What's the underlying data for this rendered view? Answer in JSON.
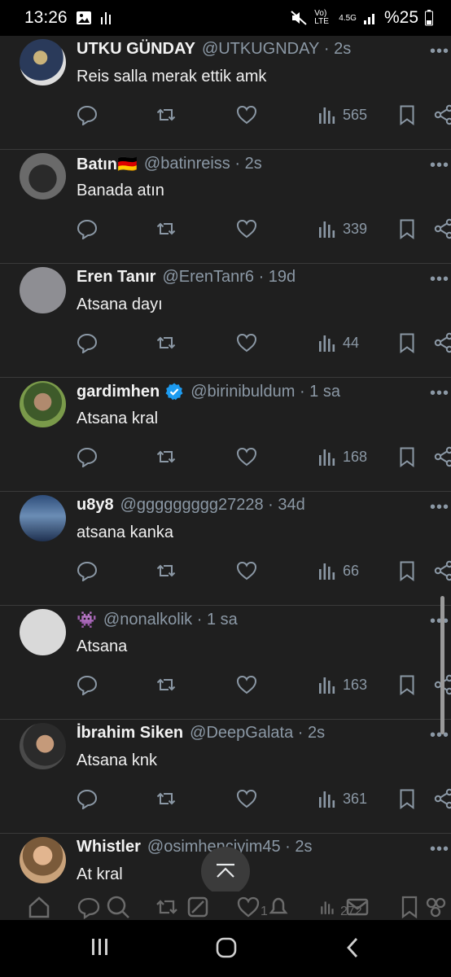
{
  "status_bar": {
    "time": "13:26",
    "network": "Vo) LTE",
    "signal": "4.5G",
    "battery": "%25"
  },
  "tweets": [
    {
      "name": "UTKU GÜNDAY",
      "handle": "@UTKUGNDAY",
      "time": "2s",
      "text": "Reis salla merak ettik amk",
      "views": "565",
      "verified": false
    },
    {
      "name": "Batın🇩🇪",
      "handle": "@batinreiss",
      "time": "2s",
      "text": "Banada atın",
      "views": "339",
      "verified": false
    },
    {
      "name": "Eren Tanır",
      "handle": "@ErenTanr6",
      "time": "19d",
      "text": "Atsana dayı",
      "views": "44",
      "verified": false
    },
    {
      "name": "gardimhen",
      "handle": "@birinibuldum",
      "time": "1 sa",
      "text": "Atsana kral",
      "views": "168",
      "verified": true
    },
    {
      "name": "u8y8",
      "handle": "@ggggggggg27228",
      "time": "34d",
      "text": "atsana kanka",
      "views": "66",
      "verified": false
    },
    {
      "name": "👾",
      "handle": "@nonalkolik",
      "time": "1 sa",
      "text": "Atsana",
      "views": "163",
      "verified": false
    },
    {
      "name": "İbrahim Siken",
      "handle": "@DeepGalata",
      "time": "2s",
      "text": "Atsana knk",
      "views": "361",
      "verified": false
    },
    {
      "name": "Whistler",
      "handle": "@osimhenciyim45",
      "time": "2s",
      "text": "At kral",
      "views": "",
      "verified": false
    }
  ],
  "partial_bar": {
    "likes": "1",
    "views": "272"
  },
  "colors": {
    "background": "#1f1f1f",
    "muted": "#8b98a5",
    "verified": "#1d9bf0"
  }
}
